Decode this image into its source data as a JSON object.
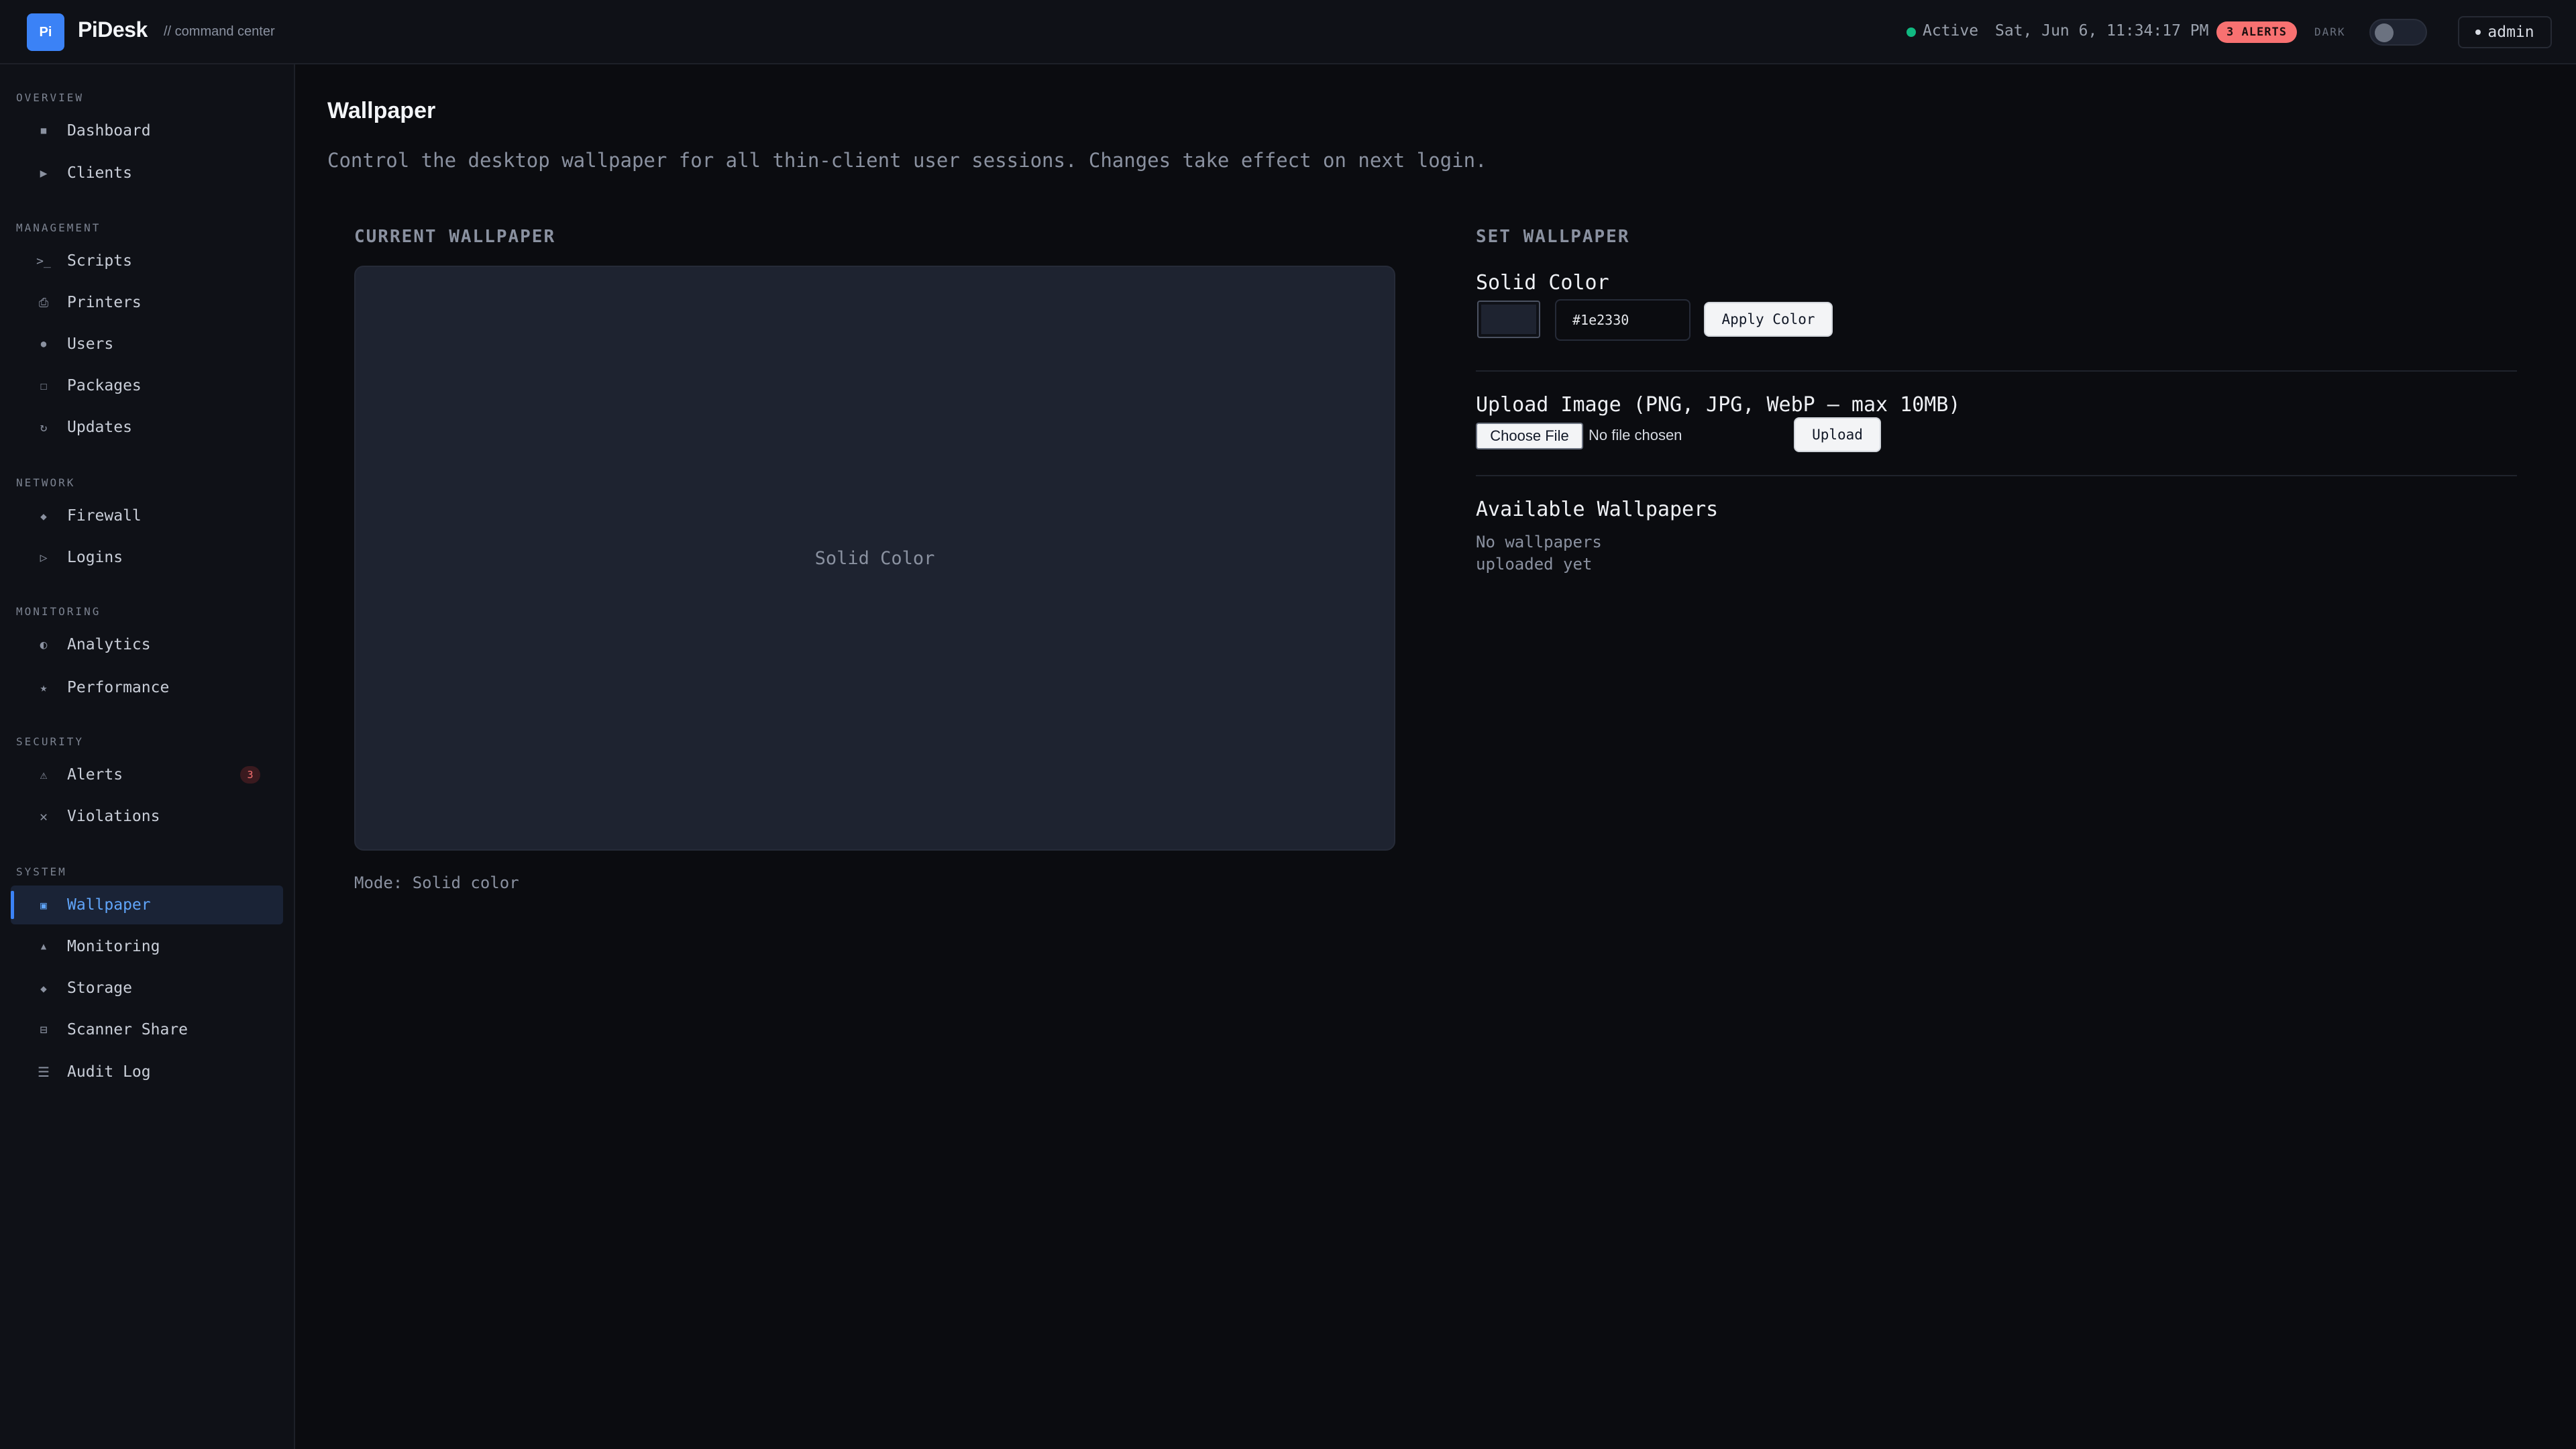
{
  "topbar": {
    "logo_text": "Pi",
    "brand": "PiDesk",
    "brand_sub": "// command center",
    "status": "Active",
    "datetime": "Sat, Jun 6, 11:34:17 PM",
    "alerts": "3 ALERTS",
    "theme_label": "DARK",
    "user": "admin"
  },
  "sidebar": {
    "sections": [
      {
        "label": "OVERVIEW",
        "items": [
          {
            "label": "Dashboard",
            "icon": "square-icon"
          },
          {
            "label": "Clients",
            "icon": "play-icon"
          }
        ]
      },
      {
        "label": "MANAGEMENT",
        "items": [
          {
            "label": "Scripts",
            "icon": "terminal-icon"
          },
          {
            "label": "Printers",
            "icon": "printer-icon"
          },
          {
            "label": "Users",
            "icon": "user-icon"
          },
          {
            "label": "Packages",
            "icon": "box-icon"
          },
          {
            "label": "Updates",
            "icon": "refresh-icon"
          }
        ]
      },
      {
        "label": "NETWORK",
        "items": [
          {
            "label": "Firewall",
            "icon": "diamond-icon"
          },
          {
            "label": "Logins",
            "icon": "triangle-icon"
          }
        ]
      },
      {
        "label": "MONITORING",
        "items": [
          {
            "label": "Analytics",
            "icon": "half-circle-icon"
          },
          {
            "label": "Performance",
            "icon": "star-icon"
          }
        ]
      },
      {
        "label": "SECURITY",
        "items": [
          {
            "label": "Alerts",
            "icon": "warning-icon",
            "badge": "3"
          },
          {
            "label": "Violations",
            "icon": "close-icon"
          }
        ]
      },
      {
        "label": "SYSTEM",
        "items": [
          {
            "label": "Wallpaper",
            "icon": "image-icon",
            "active": true
          },
          {
            "label": "Monitoring",
            "icon": "up-triangle-icon"
          },
          {
            "label": "Storage",
            "icon": "diamond-icon"
          },
          {
            "label": "Scanner Share",
            "icon": "scanner-icon"
          },
          {
            "label": "Audit Log",
            "icon": "list-icon"
          }
        ]
      }
    ]
  },
  "main": {
    "title": "Wallpaper",
    "description": "Control the desktop wallpaper for all thin-client user sessions. Changes take effect on next login.",
    "current": {
      "heading": "CURRENT WALLPAPER",
      "preview_text": "Solid Color",
      "preview_color": "#1e2330",
      "mode": "Mode: Solid color"
    },
    "set": {
      "heading": "SET WALLPAPER",
      "solid_heading": "Solid Color",
      "hex_value": "#1e2330",
      "apply_label": "Apply Color",
      "upload_heading": "Upload Image (PNG, JPG, WebP — max 10MB)",
      "choose_label": "Choose File",
      "no_file": "No file chosen",
      "upload_label": "Upload",
      "available_heading": "Available Wallpapers",
      "empty_line1": "No wallpapers",
      "empty_line2": "uploaded yet"
    }
  },
  "colors": {
    "accent": "#3b82f6",
    "alert": "#f87171",
    "status_active": "#10b981"
  }
}
